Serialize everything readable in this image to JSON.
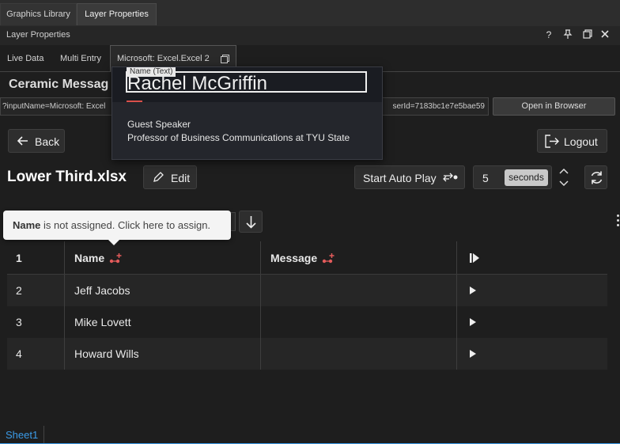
{
  "top_tabs": [
    {
      "label": "Graphics Library"
    },
    {
      "label": "Layer Properties"
    }
  ],
  "panel": {
    "title": "Layer Properties",
    "help": "?"
  },
  "sub_tabs": [
    {
      "label": "Live Data"
    },
    {
      "label": "Multi Entry"
    },
    {
      "label": "Microsoft: Excel.Excel 2"
    }
  ],
  "ceramic_title": "Ceramic Messag",
  "url": {
    "left": "?inputName=Microsoft: Excel",
    "right": "serId=7183bc1e7e5bae59"
  },
  "open_browser": "Open in Browser",
  "back_label": "Back",
  "logout_label": "Logout",
  "file_title": "Lower Third.xlsx",
  "edit_label": "Edit",
  "auto_play_label": "Start Auto Play",
  "seconds_value": "5",
  "seconds_unit": "seconds",
  "tooltip": {
    "field": "Name",
    "text": " is not assigned. Click here to assign."
  },
  "table": {
    "header": {
      "num": "1",
      "name": "Name",
      "message": "Message"
    },
    "rows": [
      {
        "num": "2",
        "name": "Jeff Jacobs",
        "message": ""
      },
      {
        "num": "3",
        "name": "Mike Lovett",
        "message": ""
      },
      {
        "num": "4",
        "name": "Howard Wills",
        "message": ""
      }
    ]
  },
  "preview": {
    "name_tag": "Name (Text)",
    "name": "Rachel McGriffin",
    "line1": "Guest Speaker",
    "line2": "Professor of Business Communications at TYU State"
  },
  "sheet_tab": "Sheet1",
  "colors": {
    "accent": "#3b9be8",
    "link_icon": "#e35b5b",
    "red_line": "#d9504a"
  }
}
